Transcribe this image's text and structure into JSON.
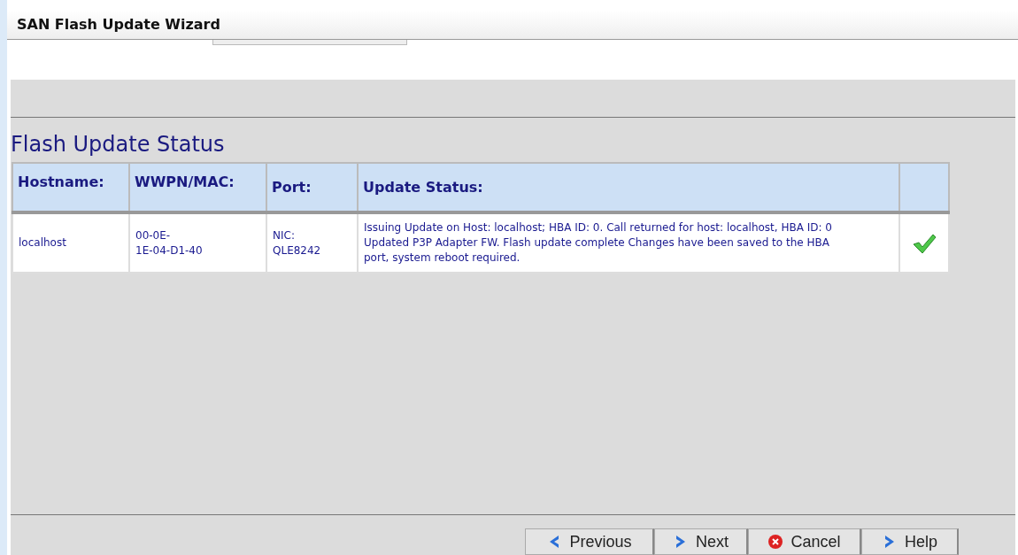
{
  "window": {
    "title": "SAN Flash Update Wizard"
  },
  "section_title": "Flash Update Status",
  "table": {
    "columns": [
      "Hostname:",
      "WWPN/MAC:",
      "Port:",
      "Update Status:"
    ],
    "rows": [
      {
        "hostname": "localhost",
        "wwpn_mac": "00-0E-\n1E-04-D1-40",
        "port": "NIC:\nQLE8242",
        "update_status": "Issuing Update on Host: localhost; HBA ID: 0.  Call returned for host: localhost, HBA ID: 0 Updated P3P Adapter FW.  Flash update complete Changes have been saved to the HBA port, system reboot required.",
        "succeeded": true
      }
    ]
  },
  "buttons": [
    {
      "label": "Previous",
      "kind": "previous"
    },
    {
      "label": "Next",
      "kind": "next"
    },
    {
      "label": "Cancel",
      "kind": "cancel"
    },
    {
      "label": "Help",
      "kind": "help"
    }
  ]
}
